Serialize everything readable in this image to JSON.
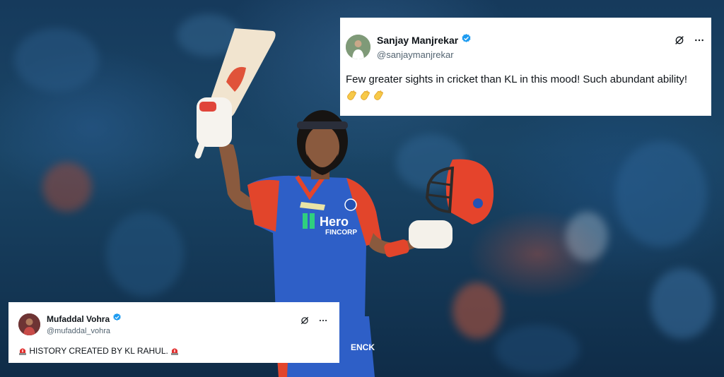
{
  "image": {
    "scene_icon": "cricketer-celebrating-century",
    "colors": {
      "jersey_blue": "#2e5fc7",
      "jersey_red": "#e2452b",
      "helmet_red": "#e5442c",
      "verified_blue": "#1d9bf0"
    }
  },
  "top_tweet": {
    "author_name": "Sanjay Manjrekar",
    "handle": "@sanjaymanjrekar",
    "text": "Few greater sights in cricket than KL in this mood! Such abundant ability!",
    "emojis": [
      "clapping-hands",
      "clapping-hands",
      "clapping-hands"
    ],
    "grok_icon": "grok-icon",
    "more_icon": "more-icon"
  },
  "bottom_tweet": {
    "author_name": "Mufaddal Vohra",
    "handle": "@mufaddal_vohra",
    "text": "HISTORY CREATED BY KL RAHUL.",
    "emoji": "police-light",
    "grok_icon": "grok-icon",
    "more_icon": "more-icon"
  },
  "jersey": {
    "sponsor_line1": "Hero",
    "sponsor_line2": "FINCORP",
    "trouser_text": "ENCK"
  }
}
